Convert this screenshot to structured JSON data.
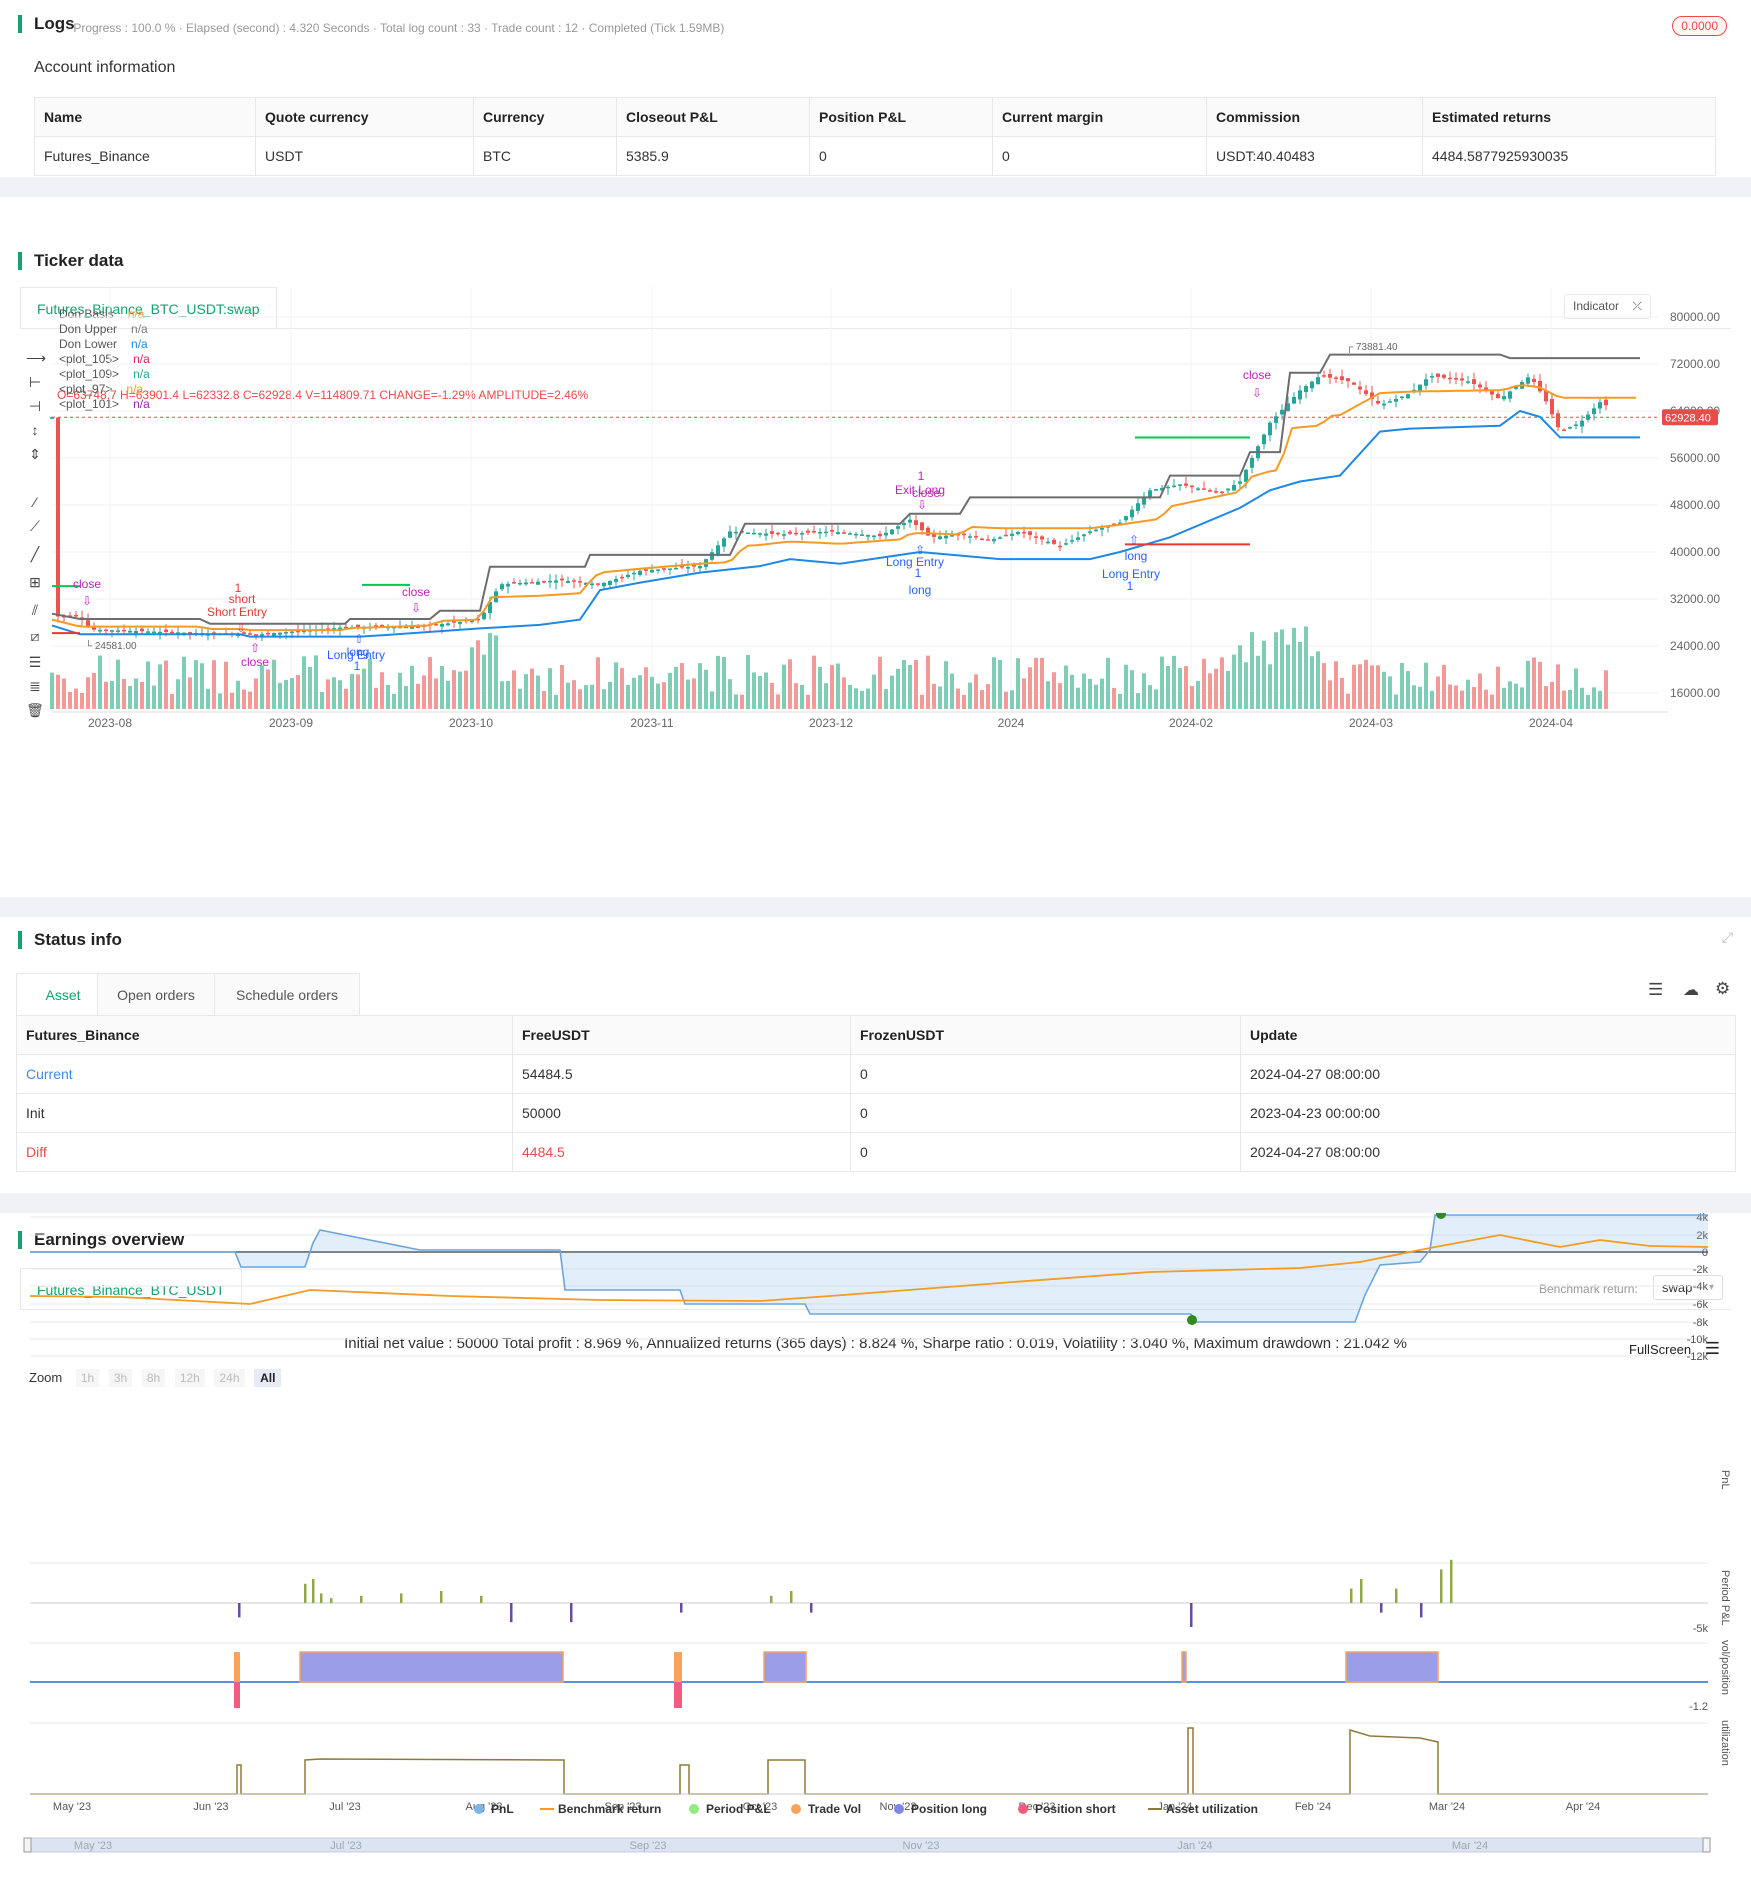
{
  "logs": {
    "title": "Logs",
    "summary": "· Progress : 100.0 % · Elapsed (second) : 4.320  Seconds · Total log count : 33 · Trade count : 12 · Completed (Tick 1.59MB)",
    "badge": "0.0000"
  },
  "account": {
    "title": "Account information",
    "headers": [
      "Name",
      "Quote currency",
      "Currency",
      "Closeout P&L",
      "Position P&L",
      "Current margin",
      "Commission",
      "Estimated returns"
    ],
    "row": [
      "Futures_Binance",
      "USDT",
      "BTC",
      "5385.9",
      "0",
      "0",
      "USDT:40.40483",
      "4484.5877925930035"
    ]
  },
  "ticker": {
    "title": "Ticker data",
    "tab": "Futures_Binance_BTC_USDT:swap",
    "ohlc": "O=63748.7 H=63901.4 L=62332.8 C=62928.4 V=114809.71 CHANGE=-1.29% AMPLITUDE=2.46%",
    "indicator_btn": "Indicator",
    "legend": [
      {
        "name": "Don Basis",
        "val": "n/a",
        "color": "#f59a23"
      },
      {
        "name": "Don Upper",
        "val": "n/a",
        "color": "#7a7a7a"
      },
      {
        "name": "Don Lower",
        "val": "n/a",
        "color": "#1e88e5"
      },
      {
        "name": "<plot_105>",
        "val": "n/a",
        "color": "#e91e63"
      },
      {
        "name": "<plot_109>",
        "val": "n/a",
        "color": "#26a69a"
      },
      {
        "name": "<plot_97>",
        "val": "n/a",
        "color": "#f59a23"
      },
      {
        "name": "<plot_101>",
        "val": "n/a",
        "color": "#9c27b0"
      }
    ],
    "price_label": "62928.40",
    "y_ticks": [
      "80000.00",
      "72000.00",
      "64000.00",
      "56000.00",
      "48000.00",
      "40000.00",
      "32000.00",
      "24000.00",
      "16000.00"
    ],
    "x_ticks": [
      "2023-08",
      "2023-09",
      "2023-10",
      "2023-11",
      "2023-12",
      "2024",
      "2024-02",
      "2024-03",
      "2024-04"
    ],
    "hi_label": "73881.40",
    "lo_label": "24581.00",
    "annotations": {
      "close": "close",
      "short": "short",
      "short_entry": "Short Entry",
      "one": "1",
      "long": "long",
      "long_entry": "Long Entry",
      "exit_long": "Exit Long"
    }
  },
  "status": {
    "title": "Status info",
    "tabs": [
      "Asset",
      "Open orders",
      "Schedule orders"
    ],
    "headers": [
      "Futures_Binance",
      "FreeUSDT",
      "FrozenUSDT",
      "Update"
    ],
    "rows": [
      [
        "Current",
        "54484.5",
        "0",
        "2024-04-27 08:00:00"
      ],
      [
        "Init",
        "50000",
        "0",
        "2023-04-23 00:00:00"
      ],
      [
        "Diff",
        "4484.5",
        "0",
        "2024-04-27 08:00:00"
      ]
    ]
  },
  "earnings": {
    "title": "Earnings overview",
    "tab": "Futures_Binance_BTC_USDT",
    "benchmark_label": "Benchmark return:",
    "benchmark_value": "swap",
    "summary": "Initial net value : 50000  Total profit : 8.969 %, Annualized returns (365 days) : 8.824 %, Sharpe ratio : 0.019, Volatility : 3.040 %, Maximum drawdown : 21.042 %",
    "fullscreen": "FullScreen",
    "zoom_label": "Zoom",
    "zoom_options": [
      "1h",
      "3h",
      "8h",
      "12h",
      "24h",
      "All"
    ],
    "pnl_ticks": [
      "4k",
      "2k",
      "0",
      "-2k",
      "-4k",
      "-6k",
      "-8k",
      "-10k",
      "-12k"
    ],
    "pnl_axis": "PnL",
    "period_axis": "Period P&L",
    "period_tick": "-5k",
    "pos_axis": "vol/position",
    "pos_tick": "-1.2",
    "util_axis": "utilization",
    "x_ticks": [
      "May '23",
      "Jun '23",
      "Jul '23",
      "Aug '23",
      "Sep '23",
      "Oct '23",
      "Nov '23",
      "Dec '23",
      "Jan '24",
      "Feb '24",
      "Mar '24",
      "Apr '24"
    ],
    "nav_ticks": [
      "May '23",
      "Jul '23",
      "Sep '23",
      "Nov '23",
      "Jan '24",
      "Mar '24"
    ],
    "legend": [
      {
        "name": "PnL",
        "color": "#7cb5ec"
      },
      {
        "name": "Benchmark return",
        "color": "#f59a23"
      },
      {
        "name": "Period P&L",
        "color": "#90ed7d"
      },
      {
        "name": "Trade Vol",
        "color": "#f7a35c"
      },
      {
        "name": "Position long",
        "color": "#8085e9"
      },
      {
        "name": "Position short",
        "color": "#f15c80"
      },
      {
        "name": "Asset utilization",
        "color": "#8d7a3a"
      }
    ]
  }
}
